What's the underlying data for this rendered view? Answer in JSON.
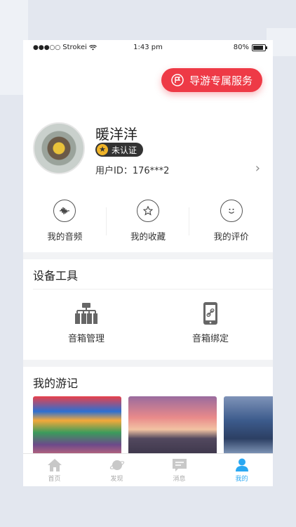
{
  "status_bar": {
    "carrier": "Strokei",
    "time": "1:43 pm",
    "battery": "80%"
  },
  "guide_button": {
    "label": "导游专属服务"
  },
  "profile": {
    "name": "暖洋洋",
    "badge": "未认证",
    "user_id": "用户ID：176***2"
  },
  "quick_actions": [
    {
      "label": "我的音频",
      "icon": "audio-wave-icon"
    },
    {
      "label": "我的收藏",
      "icon": "star-icon"
    },
    {
      "label": "我的评价",
      "icon": "smiley-icon"
    }
  ],
  "devices": {
    "title": "设备工具",
    "items": [
      {
        "label": "音箱管理",
        "icon": "speaker-manage-icon"
      },
      {
        "label": "音箱绑定",
        "icon": "phone-link-icon"
      }
    ]
  },
  "travel": {
    "title": "我的游记"
  },
  "tabs": [
    {
      "label": "首页",
      "icon": "home-icon"
    },
    {
      "label": "发现",
      "icon": "planet-icon"
    },
    {
      "label": "消息",
      "icon": "message-icon"
    },
    {
      "label": "我的",
      "icon": "user-icon",
      "active": true
    }
  ],
  "colors": {
    "accent_red": "#ee3a46",
    "active_blue": "#2aa8f2"
  }
}
